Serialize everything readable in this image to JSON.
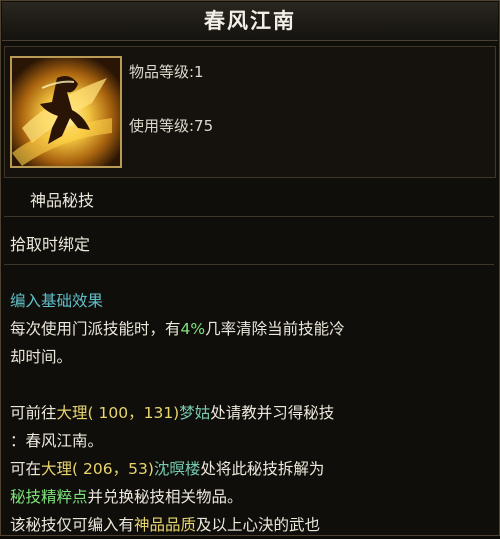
{
  "item": {
    "name": "春风江南",
    "item_level_label": "物品等级:1",
    "use_level_label": "使用等级:75",
    "quality": "神品秘技",
    "binding": "拾取时绑定"
  },
  "effect": {
    "heading": "编入基础效果",
    "line1_a": "每次使用门派技能时，有",
    "line1_pct": "4%",
    "line1_b": "几率清除当前技能冷",
    "line2": "却时间。"
  },
  "source": {
    "l1_a": "可前往",
    "l1_place": "大理",
    "l1_coord": "( 100，131)",
    "l1_npc": "梦姑",
    "l1_b": "处请教并习得秘技",
    "l2": "：春风江南。",
    "l3_a": "可在",
    "l3_place": "大理",
    "l3_coord": "( 206，53)",
    "l3_npc": "沈暝楼",
    "l3_b": "处将此秘技拆解为",
    "l4_hl": "秘技精粹点",
    "l4_b": "并兑换秘技相关物品。",
    "l5_a": "该秘技仅可编入有",
    "l5_hl": "神品品质",
    "l5_b": "及以上心決的武也"
  },
  "colors": {
    "highlight_green": "#7ee37d",
    "place_yellow": "#e9d56d",
    "npc_teal": "#77c9b0",
    "heading_cyan": "#5fc0c9"
  },
  "icon": "golden-martial-artist-skill-icon"
}
